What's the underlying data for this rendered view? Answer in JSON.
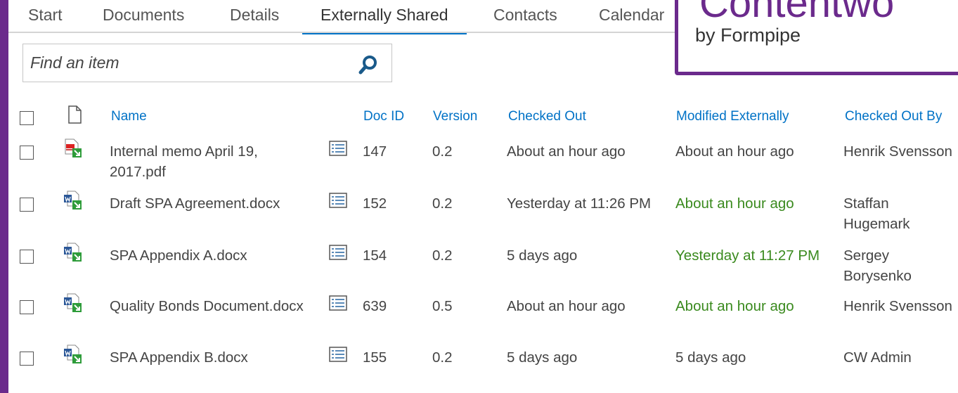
{
  "tabs": [
    "Start",
    "Documents",
    "Details",
    "Externally Shared",
    "Contacts",
    "Calendar"
  ],
  "active_tab": "Externally Shared",
  "logo": {
    "word": "Contentwo",
    "sub": "by Formpipe"
  },
  "search": {
    "placeholder": "Find an item",
    "icon": "search-icon"
  },
  "columns": {
    "name": "Name",
    "doc_id": "Doc ID",
    "version": "Version",
    "checked_out": "Checked Out",
    "modified_externally": "Modified Externally",
    "checked_out_by": "Checked Out By"
  },
  "rows": [
    {
      "name": "Internal memo April 19, 2017.pdf",
      "file_type": "pdf",
      "doc_id": "147",
      "version": "0.2",
      "checked_out": "About an hour ago",
      "modified_externally": "About an hour ago",
      "modified_highlight": false,
      "checked_out_by": "Henrik Svensson"
    },
    {
      "name": "Draft SPA Agreement.docx",
      "file_type": "docx",
      "doc_id": "152",
      "version": "0.2",
      "checked_out": "Yesterday at 11:26 PM",
      "modified_externally": "About an hour ago",
      "modified_highlight": true,
      "checked_out_by": "Staffan Hugemark"
    },
    {
      "name": "SPA Appendix A.docx",
      "file_type": "docx",
      "doc_id": "154",
      "version": "0.2",
      "checked_out": "5 days ago",
      "modified_externally": "Yesterday at 11:27 PM",
      "modified_highlight": true,
      "checked_out_by": "Sergey Borysenko"
    },
    {
      "name": "Quality Bonds Document.docx",
      "file_type": "docx",
      "doc_id": "639",
      "version": "0.5",
      "checked_out": "About an hour ago",
      "modified_externally": "About an hour ago",
      "modified_highlight": true,
      "checked_out_by": "Henrik Svensson"
    },
    {
      "name": "SPA Appendix B.docx",
      "file_type": "docx",
      "doc_id": "155",
      "version": "0.2",
      "checked_out": "5 days ago",
      "modified_externally": "5 days ago",
      "modified_highlight": false,
      "checked_out_by": "CW Admin"
    }
  ],
  "colors": {
    "frame": "#6b2a8c",
    "link": "#0072c6",
    "highlight": "#3a8a1e",
    "text": "#444444"
  }
}
